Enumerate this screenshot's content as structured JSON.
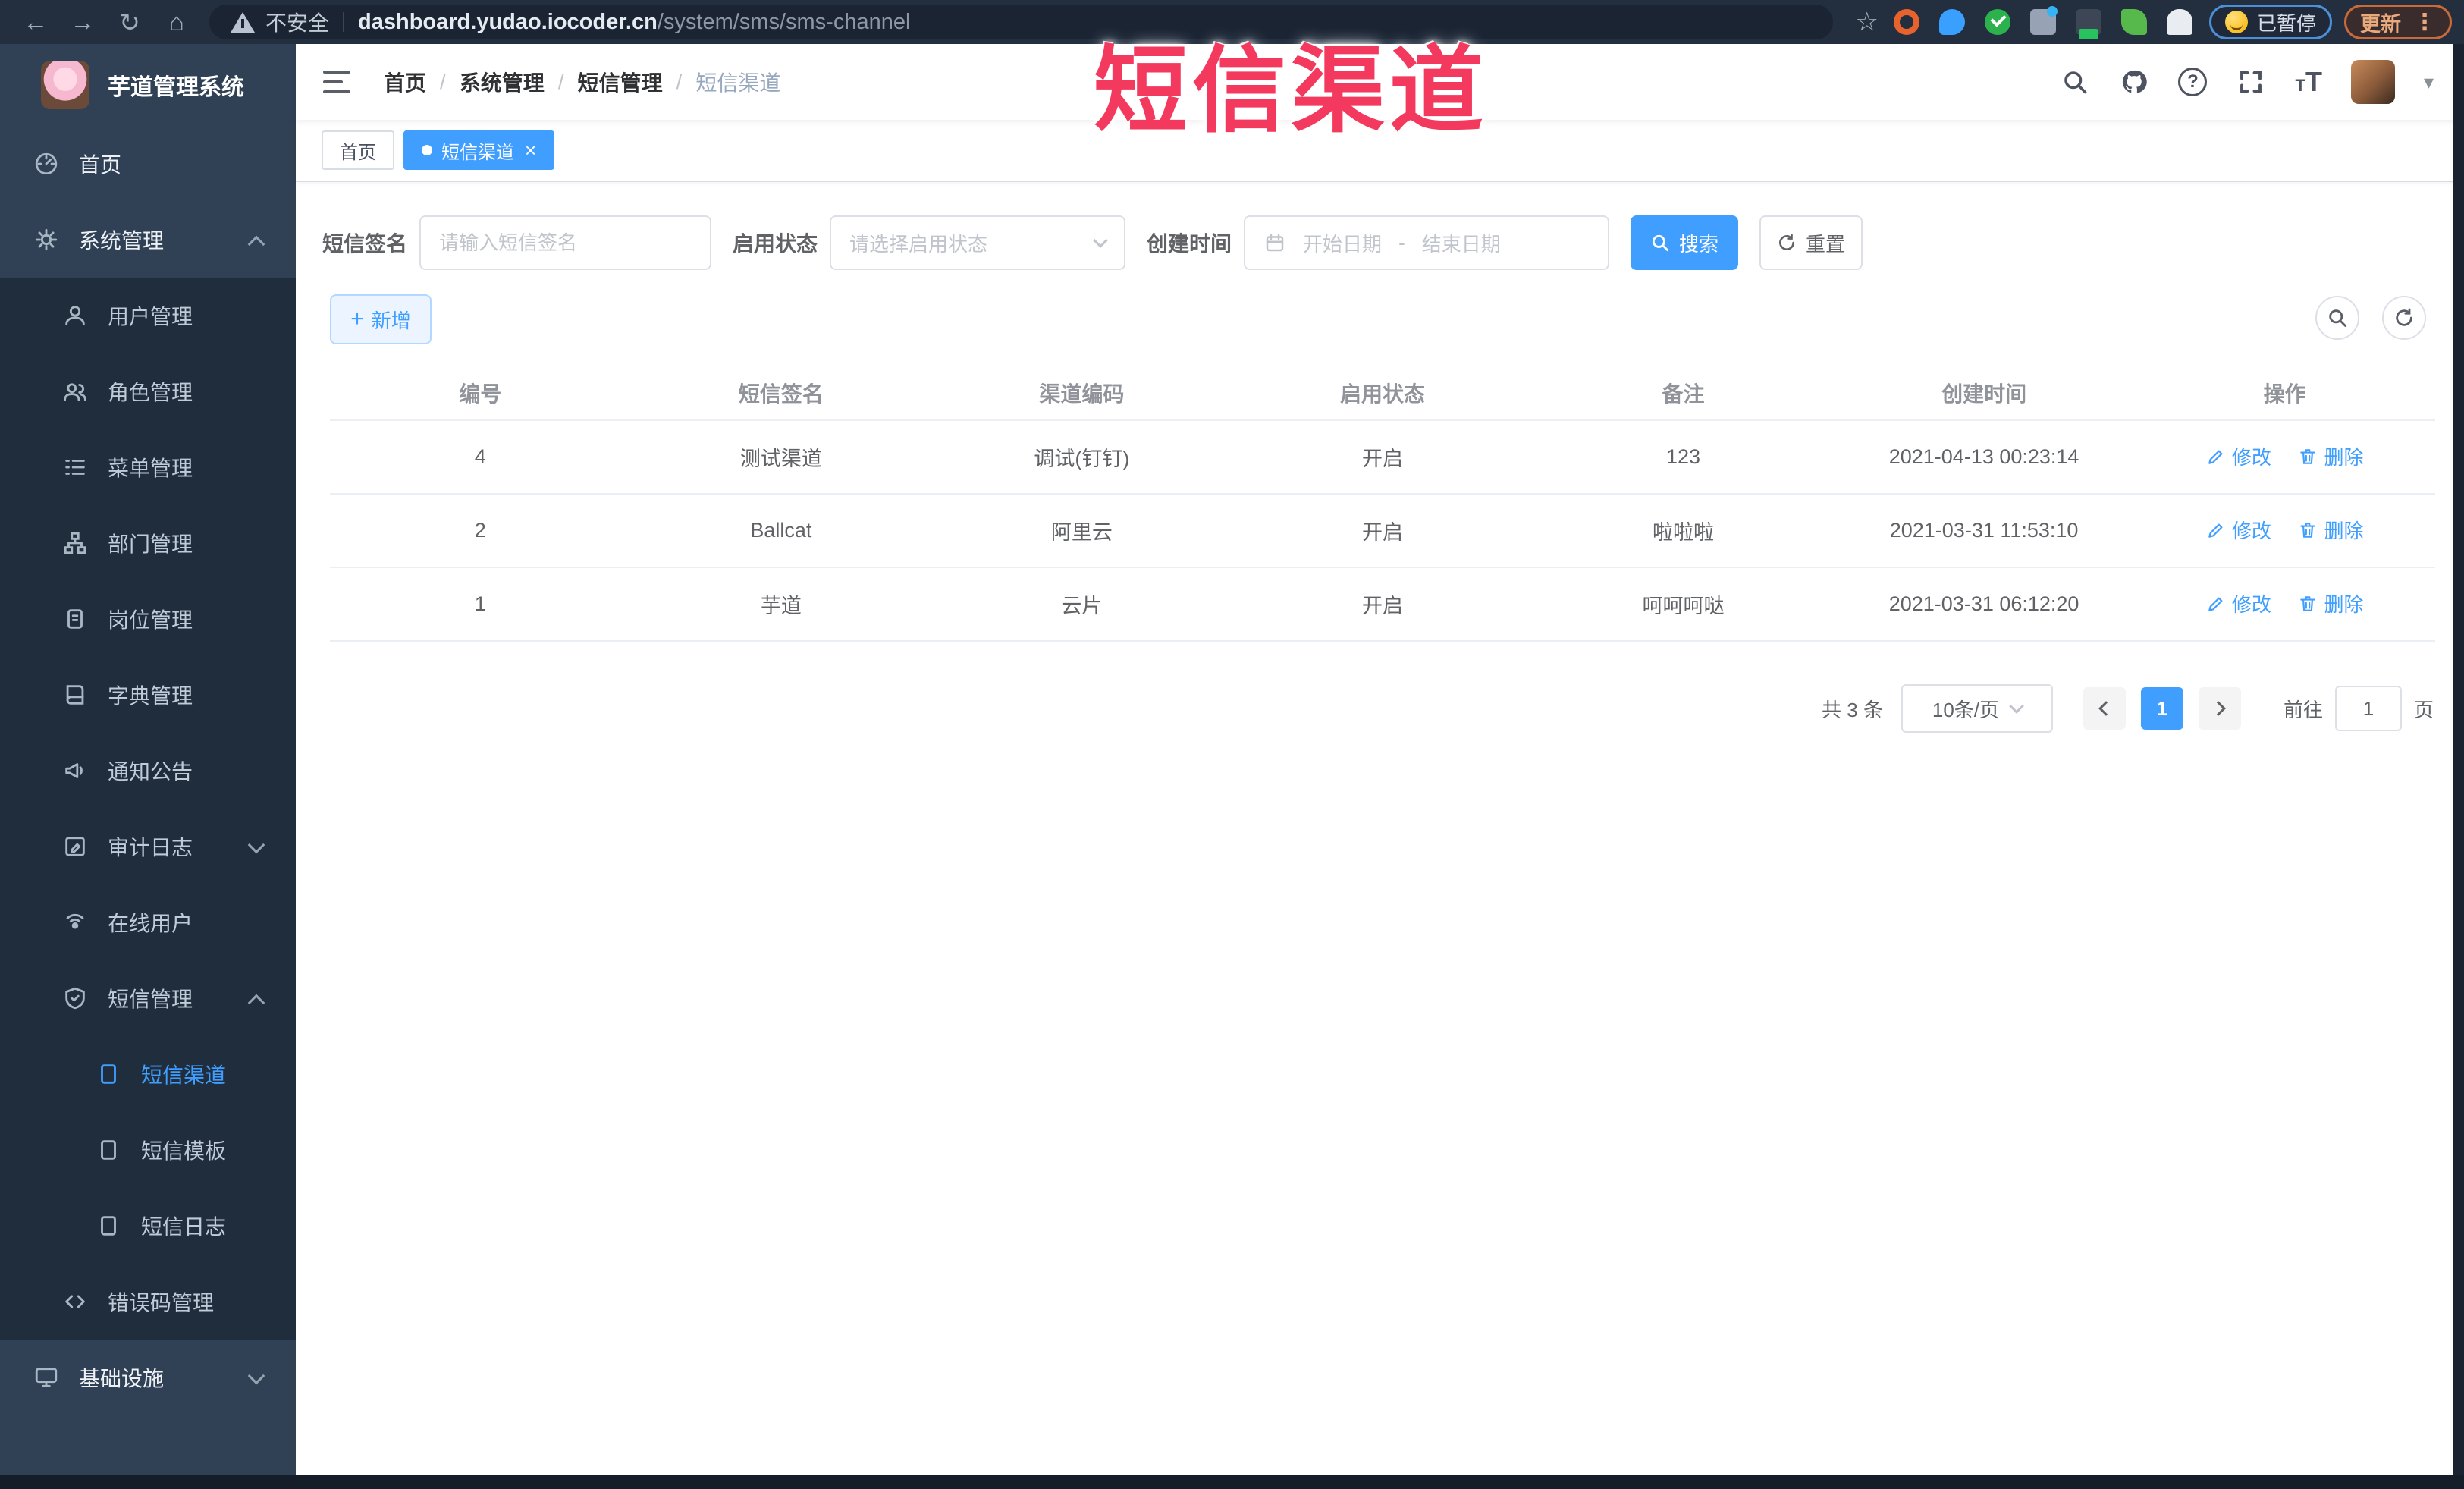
{
  "browser": {
    "security_label": "不安全",
    "url_domain": "dashboard.yudao.iocoder.cn",
    "url_path": "/system/sms/sms-channel",
    "paused_label": "已暂停",
    "update_label": "更新"
  },
  "glyphs": {
    "back": "←",
    "forward": "→",
    "reload": "↻",
    "home": "⌂",
    "star": "☆",
    "menu_dots": "⋮",
    "caret_down": "▾",
    "close": "×",
    "plus": "+",
    "question": "?",
    "font_size_small": "T",
    "font_size_large": "T"
  },
  "watermark": {
    "text": "短信渠道",
    "color": "#f4395f"
  },
  "sidebar": {
    "app_title": "芋道管理系统",
    "items": [
      {
        "label": "首页"
      },
      {
        "label": "系统管理"
      },
      {
        "label": "用户管理"
      },
      {
        "label": "角色管理"
      },
      {
        "label": "菜单管理"
      },
      {
        "label": "部门管理"
      },
      {
        "label": "岗位管理"
      },
      {
        "label": "字典管理"
      },
      {
        "label": "通知公告"
      },
      {
        "label": "审计日志"
      },
      {
        "label": "在线用户"
      },
      {
        "label": "短信管理"
      },
      {
        "label": "短信渠道"
      },
      {
        "label": "短信模板"
      },
      {
        "label": "短信日志"
      },
      {
        "label": "错误码管理"
      },
      {
        "label": "基础设施"
      }
    ]
  },
  "breadcrumb": {
    "separator": "/",
    "items": [
      "首页",
      "系统管理",
      "短信管理",
      "短信渠道"
    ]
  },
  "tabs": [
    {
      "label": "首页"
    },
    {
      "label": "短信渠道"
    }
  ],
  "filters": {
    "signature_label": "短信签名",
    "signature_placeholder": "请输入短信签名",
    "status_label": "启用状态",
    "status_placeholder": "请选择启用状态",
    "time_label": "创建时间",
    "date_start_placeholder": "开始日期",
    "date_separator": "-",
    "date_end_placeholder": "结束日期",
    "search_label": "搜索",
    "reset_label": "重置"
  },
  "toolbar": {
    "add_label": "新增"
  },
  "table": {
    "headers": [
      "编号",
      "短信签名",
      "渠道编码",
      "启用状态",
      "备注",
      "创建时间",
      "操作"
    ],
    "edit_label": "修改",
    "delete_label": "删除",
    "rows": [
      {
        "id": "4",
        "signature": "测试渠道",
        "code": "调试(钉钉)",
        "status": "开启",
        "remark": "123",
        "created": "2021-04-13 00:23:14"
      },
      {
        "id": "2",
        "signature": "Ballcat",
        "code": "阿里云",
        "status": "开启",
        "remark": "啦啦啦",
        "created": "2021-03-31 11:53:10"
      },
      {
        "id": "1",
        "signature": "芋道",
        "code": "云片",
        "status": "开启",
        "remark": "呵呵呵哒",
        "created": "2021-03-31 06:12:20"
      }
    ]
  },
  "pagination": {
    "total": "共 3 条",
    "page_size": "10条/页",
    "page": "1",
    "goto_label": "前往",
    "goto_value": "1",
    "unit_label": "页"
  },
  "colors": {
    "primary": "#409EFF",
    "sidebar_bg": "#304156",
    "submenu_bg": "#1f2d3d",
    "watermark": "#f4395f"
  }
}
